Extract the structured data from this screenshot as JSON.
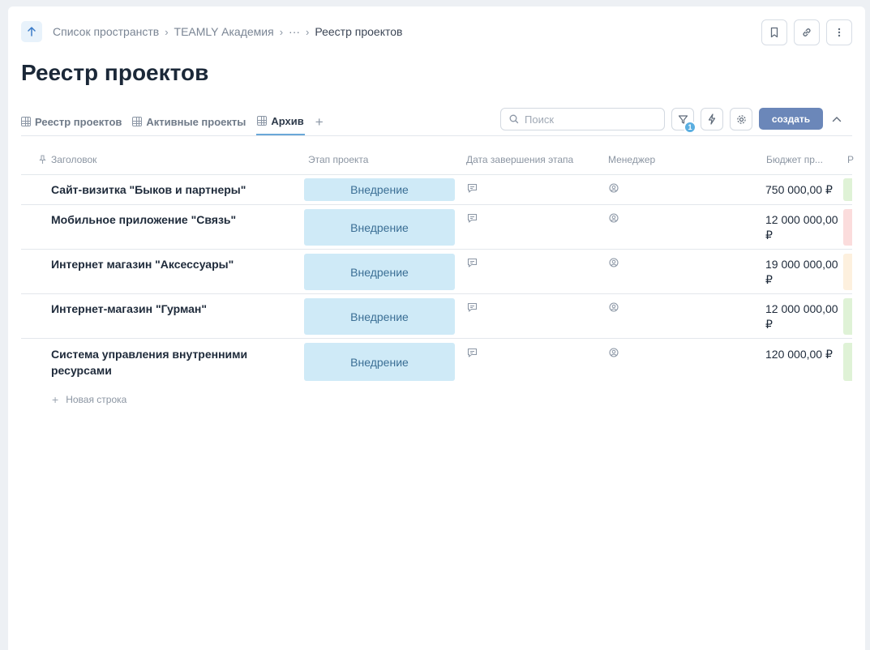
{
  "breadcrumb": {
    "items": [
      "Список пространств",
      "TEAMLY Академия",
      "···",
      "Реестр проектов"
    ]
  },
  "page": {
    "title": "Реестр проектов"
  },
  "tabs": [
    {
      "label": "Реестр проектов",
      "active": false
    },
    {
      "label": "Активные проекты",
      "active": false
    },
    {
      "label": "Архив",
      "active": true
    }
  ],
  "toolbar": {
    "search_placeholder": "Поиск",
    "filter_count": "1",
    "create_label": "создать"
  },
  "table": {
    "columns": [
      "Заголовок",
      "Этап проекта",
      "Дата завершения этапа",
      "Менеджер",
      "Бюджет пр...",
      "Р"
    ],
    "rows": [
      {
        "title": "Сайт-визитка \"Быков и партнеры\"",
        "stage": "Внедрение",
        "budget": "750 000,00 ₽",
        "status_color": "#dff2d6"
      },
      {
        "title": "Мобильное приложение \"Связь\"",
        "stage": "Внедрение",
        "budget": "12 000 000,00 ₽",
        "status_color": "#fbdcdc"
      },
      {
        "title": "Интернет магазин \"Аксессуары\"",
        "stage": "Внедрение",
        "budget": "19 000 000,00 ₽",
        "status_color": "#fdf0de"
      },
      {
        "title": "Интернет-магазин \"Гурман\"",
        "stage": "Внедрение",
        "budget": "12 000 000,00 ₽",
        "status_color": "#dff2d6"
      },
      {
        "title": "Система управления внутренними ресурсами",
        "stage": "Внедрение",
        "budget": "120 000,00 ₽",
        "status_color": "#dff2d6"
      }
    ],
    "new_row_label": "Новая строка"
  },
  "colors": {
    "accent": "#6b87b9",
    "stage_bg": "#cfeaf7",
    "tab_underline": "#6aa8d8",
    "badge": "#5aaee0"
  },
  "icons": [
    "arrow-up-icon",
    "bookmark-icon",
    "link-icon",
    "more-vertical-icon",
    "grid-icon",
    "plus-icon",
    "search-icon",
    "filter-icon",
    "lightning-icon",
    "gear-icon",
    "chevron-up-icon",
    "pin-icon",
    "comment-icon",
    "user-icon"
  ]
}
